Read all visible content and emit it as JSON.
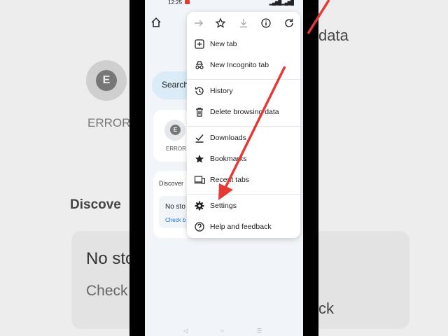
{
  "status_bar": {
    "time": "12:25"
  },
  "background_left": {
    "avatar_letter": "E",
    "label": "ERROR",
    "discover": "Discove",
    "no_stories": "No sto",
    "check": "Check"
  },
  "background_right": {
    "data_text": "data",
    "ck_text": "ck"
  },
  "home_page": {
    "search_text": "Search",
    "tile": {
      "letter": "E",
      "label": "ERROR"
    },
    "discover_title": "Discover",
    "no_stories": "No sto",
    "check_link": "Check b"
  },
  "menu": {
    "toolbar_icons": [
      "forward-icon",
      "bookmark-star-icon",
      "download-icon",
      "info-icon",
      "reload-icon"
    ],
    "items": [
      {
        "label": "New tab",
        "icon": "plus-box-icon"
      },
      {
        "label": "New Incognito tab",
        "icon": "incognito-icon"
      },
      {
        "label": "History",
        "icon": "history-icon"
      },
      {
        "label": "Delete browsing data",
        "icon": "trash-icon"
      },
      {
        "label": "Downloads",
        "icon": "downloads-icon"
      },
      {
        "label": "Bookmarks",
        "icon": "star-icon"
      },
      {
        "label": "Recent tabs",
        "icon": "devices-icon"
      },
      {
        "label": "Settings",
        "icon": "gear-icon"
      },
      {
        "label": "Help and feedback",
        "icon": "help-icon"
      }
    ]
  },
  "colors": {
    "arrow": "#e53935",
    "accent": "#1a73e8"
  }
}
